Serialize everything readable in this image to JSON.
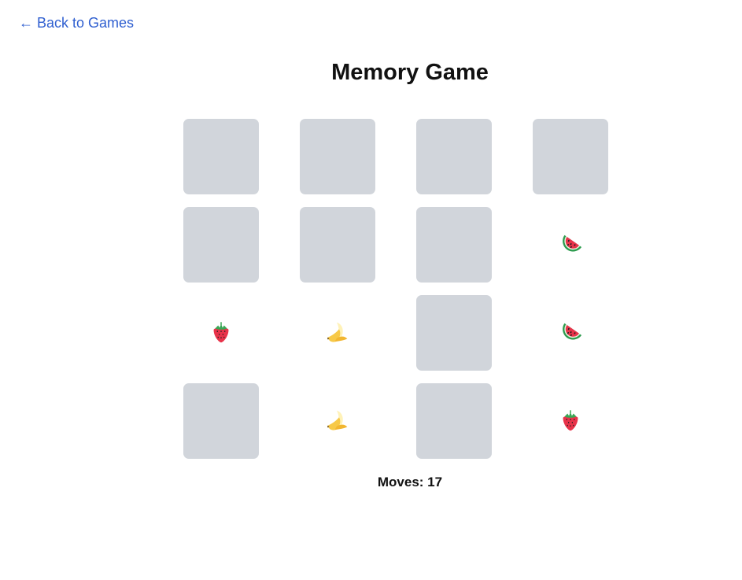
{
  "nav": {
    "back_label": "← Back to Games"
  },
  "header": {
    "title": "Memory Game"
  },
  "board": {
    "columns": 4,
    "cards": [
      {
        "state": "hidden"
      },
      {
        "state": "hidden"
      },
      {
        "state": "hidden"
      },
      {
        "state": "hidden"
      },
      {
        "state": "hidden"
      },
      {
        "state": "hidden"
      },
      {
        "state": "hidden"
      },
      {
        "state": "revealed",
        "icon": "watermelon-icon"
      },
      {
        "state": "revealed",
        "icon": "strawberry-icon"
      },
      {
        "state": "revealed",
        "icon": "banana-icon"
      },
      {
        "state": "hidden"
      },
      {
        "state": "revealed",
        "icon": "watermelon-icon"
      },
      {
        "state": "hidden"
      },
      {
        "state": "revealed",
        "icon": "banana-icon"
      },
      {
        "state": "hidden"
      },
      {
        "state": "revealed",
        "icon": "strawberry-icon"
      }
    ]
  },
  "status": {
    "moves_label": "Moves: 17"
  },
  "colors": {
    "card_back": "#d1d5db",
    "link": "#2f5fd0",
    "text": "#111111"
  }
}
